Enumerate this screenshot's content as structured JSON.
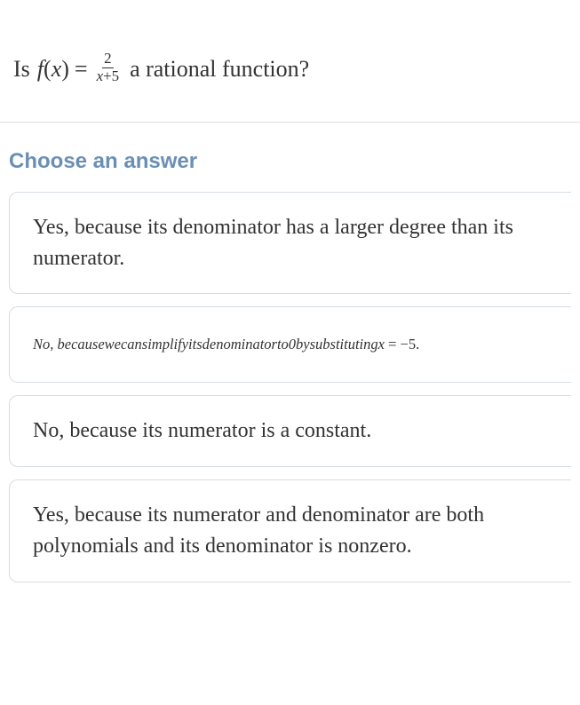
{
  "question": {
    "prefix": "Is",
    "func_f": "f",
    "open_paren": "(",
    "var_x": "x",
    "close_paren": ")",
    "equals": "=",
    "frac_num": "2",
    "frac_den_var": "x",
    "frac_den_plus": "+",
    "frac_den_const": "5",
    "suffix": "a rational function?"
  },
  "choose_label": "Choose an answer",
  "answers": {
    "a": "Yes, because its denominator has a larger degree than its numerator.",
    "b_text": "No, becausewecansimplifyitsdenominatorto0bysubstitutingx",
    "b_eq": " = ",
    "b_val": "−5.",
    "c": "No, because its numerator is a constant.",
    "d": "Yes, because its numerator and denominator are both polynomials and its denominator is nonzero."
  }
}
